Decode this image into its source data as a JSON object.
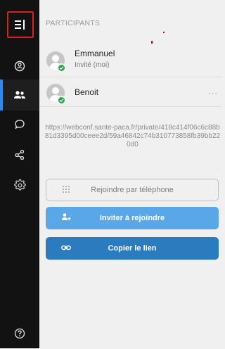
{
  "sidebar": {
    "items": [
      {
        "name": "menu-toggle",
        "icon": "menu-icon"
      },
      {
        "name": "profile",
        "icon": "smile-icon"
      },
      {
        "name": "participants",
        "icon": "people-icon",
        "active": true
      },
      {
        "name": "chat",
        "icon": "chat-bubble-icon"
      },
      {
        "name": "share",
        "icon": "share-icon"
      },
      {
        "name": "settings",
        "icon": "gear-icon"
      },
      {
        "name": "help",
        "icon": "help-icon"
      }
    ],
    "accent_color": "#2c8cf4"
  },
  "panel": {
    "title": "PARTICIPANTS",
    "participants": [
      {
        "name": "Emmanuel",
        "subtitle": "Invité (moi)",
        "status_color": "#31a24c"
      },
      {
        "name": "Benoit",
        "more_label": "···",
        "status_color": "#31a24c"
      }
    ],
    "meeting_link": "https://webconf.sante-paca.fr/private/418c414f06c6c88b81d3395d00ceee2d/59a46842c74b310773858fb39bb220d0",
    "buttons": {
      "phone_label": "Rejoindre par téléphone",
      "invite_label": "Inviter à rejoindre",
      "copy_label": "Copier le lien"
    },
    "colors": {
      "invite": "#5aa7e8",
      "copy": "#2b7bbf"
    }
  }
}
